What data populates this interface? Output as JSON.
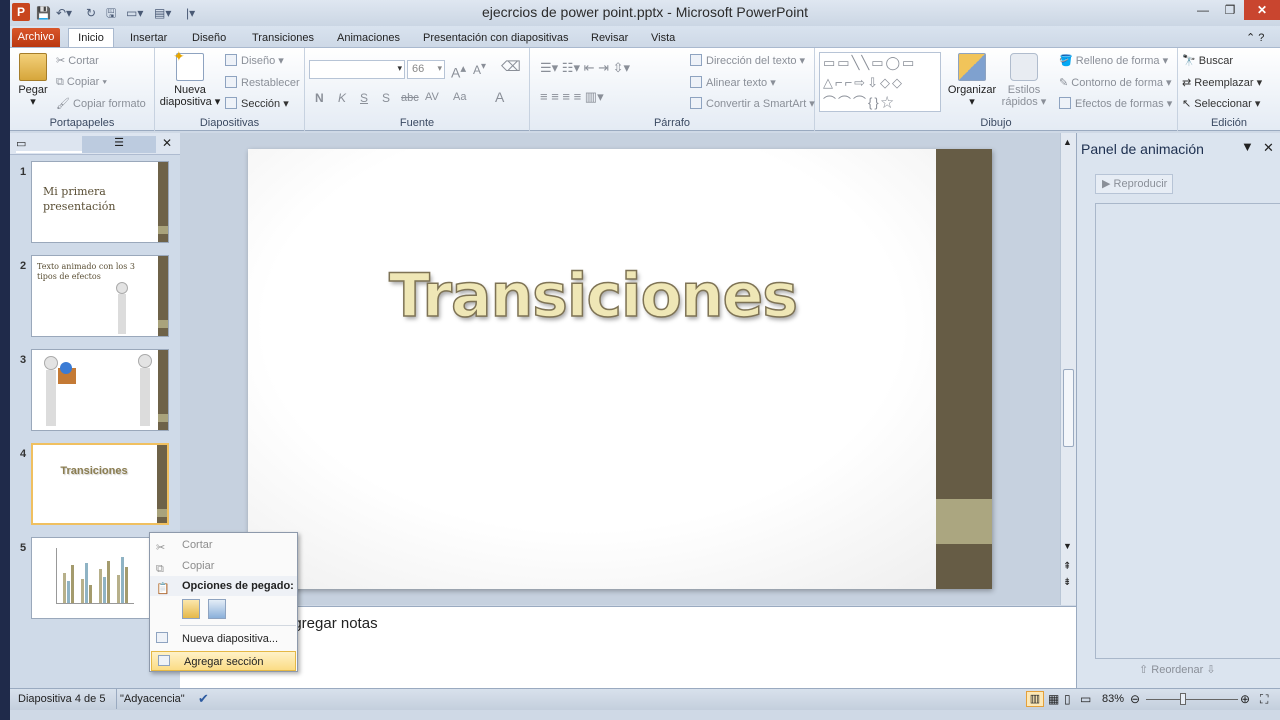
{
  "window": {
    "title": "ejecrcios de power point.pptx - Microsoft PowerPoint",
    "app_letter": "P"
  },
  "tabs": [
    {
      "label": "Archivo"
    },
    {
      "label": "Inicio"
    },
    {
      "label": "Insertar"
    },
    {
      "label": "Diseño"
    },
    {
      "label": "Transiciones"
    },
    {
      "label": "Animaciones"
    },
    {
      "label": "Presentación con diapositivas"
    },
    {
      "label": "Revisar"
    },
    {
      "label": "Vista"
    }
  ],
  "ribbon": {
    "portapapeles": {
      "label": "Portapapeles",
      "paste": "Pegar",
      "cut": "Cortar",
      "copy": "Copiar",
      "format_painter": "Copiar formato"
    },
    "diapositivas": {
      "label": "Diapositivas",
      "new_slide": "Nueva",
      "new_slide_2": "diapositiva",
      "layout": "Diseño",
      "reset": "Restablecer",
      "section": "Sección"
    },
    "fuente": {
      "label": "Fuente",
      "size": "66",
      "bold": "N",
      "italic": "K",
      "underline": "S",
      "strike": "S",
      "abc": "abc",
      "av": "AV",
      "aa": "Aa",
      "a": "A"
    },
    "parrafo": {
      "label": "Párrafo",
      "text_dir": "Dirección del texto",
      "align_text": "Alinear texto",
      "smartart": "Convertir a SmartArt"
    },
    "dibujo": {
      "label": "Dibujo",
      "arrange": "Organizar",
      "quick_styles": "Estilos",
      "quick_styles_2": "rápidos",
      "fill": "Relleno de forma",
      "outline": "Contorno de forma",
      "effects": "Efectos de formas"
    },
    "edicion": {
      "label": "Edición",
      "find": "Buscar",
      "replace": "Reemplazar",
      "select": "Seleccionar"
    }
  },
  "thumbnails": [
    {
      "num": "1",
      "text": "Mi primera presentación"
    },
    {
      "num": "2",
      "text": "Texto animado con los 3 tipos de efectos"
    },
    {
      "num": "3",
      "text": ""
    },
    {
      "num": "4",
      "text": "Transiciones"
    },
    {
      "num": "5",
      "text": ""
    }
  ],
  "slide": {
    "title": "Transiciones"
  },
  "notes": {
    "placeholder": "agregar notas"
  },
  "animation_pane": {
    "title": "Panel de animación",
    "play": "Reproducir",
    "reorder": "Reordenar"
  },
  "context_menu": {
    "cut": "Cortar",
    "copy": "Copiar",
    "paste_options": "Opciones de pegado:",
    "new_slide": "Nueva diapositiva...",
    "add_section": "Agregar sección"
  },
  "status": {
    "slide_info": "Diapositiva 4 de 5",
    "theme": "\"Adyacencia\"",
    "zoom": "83%"
  }
}
